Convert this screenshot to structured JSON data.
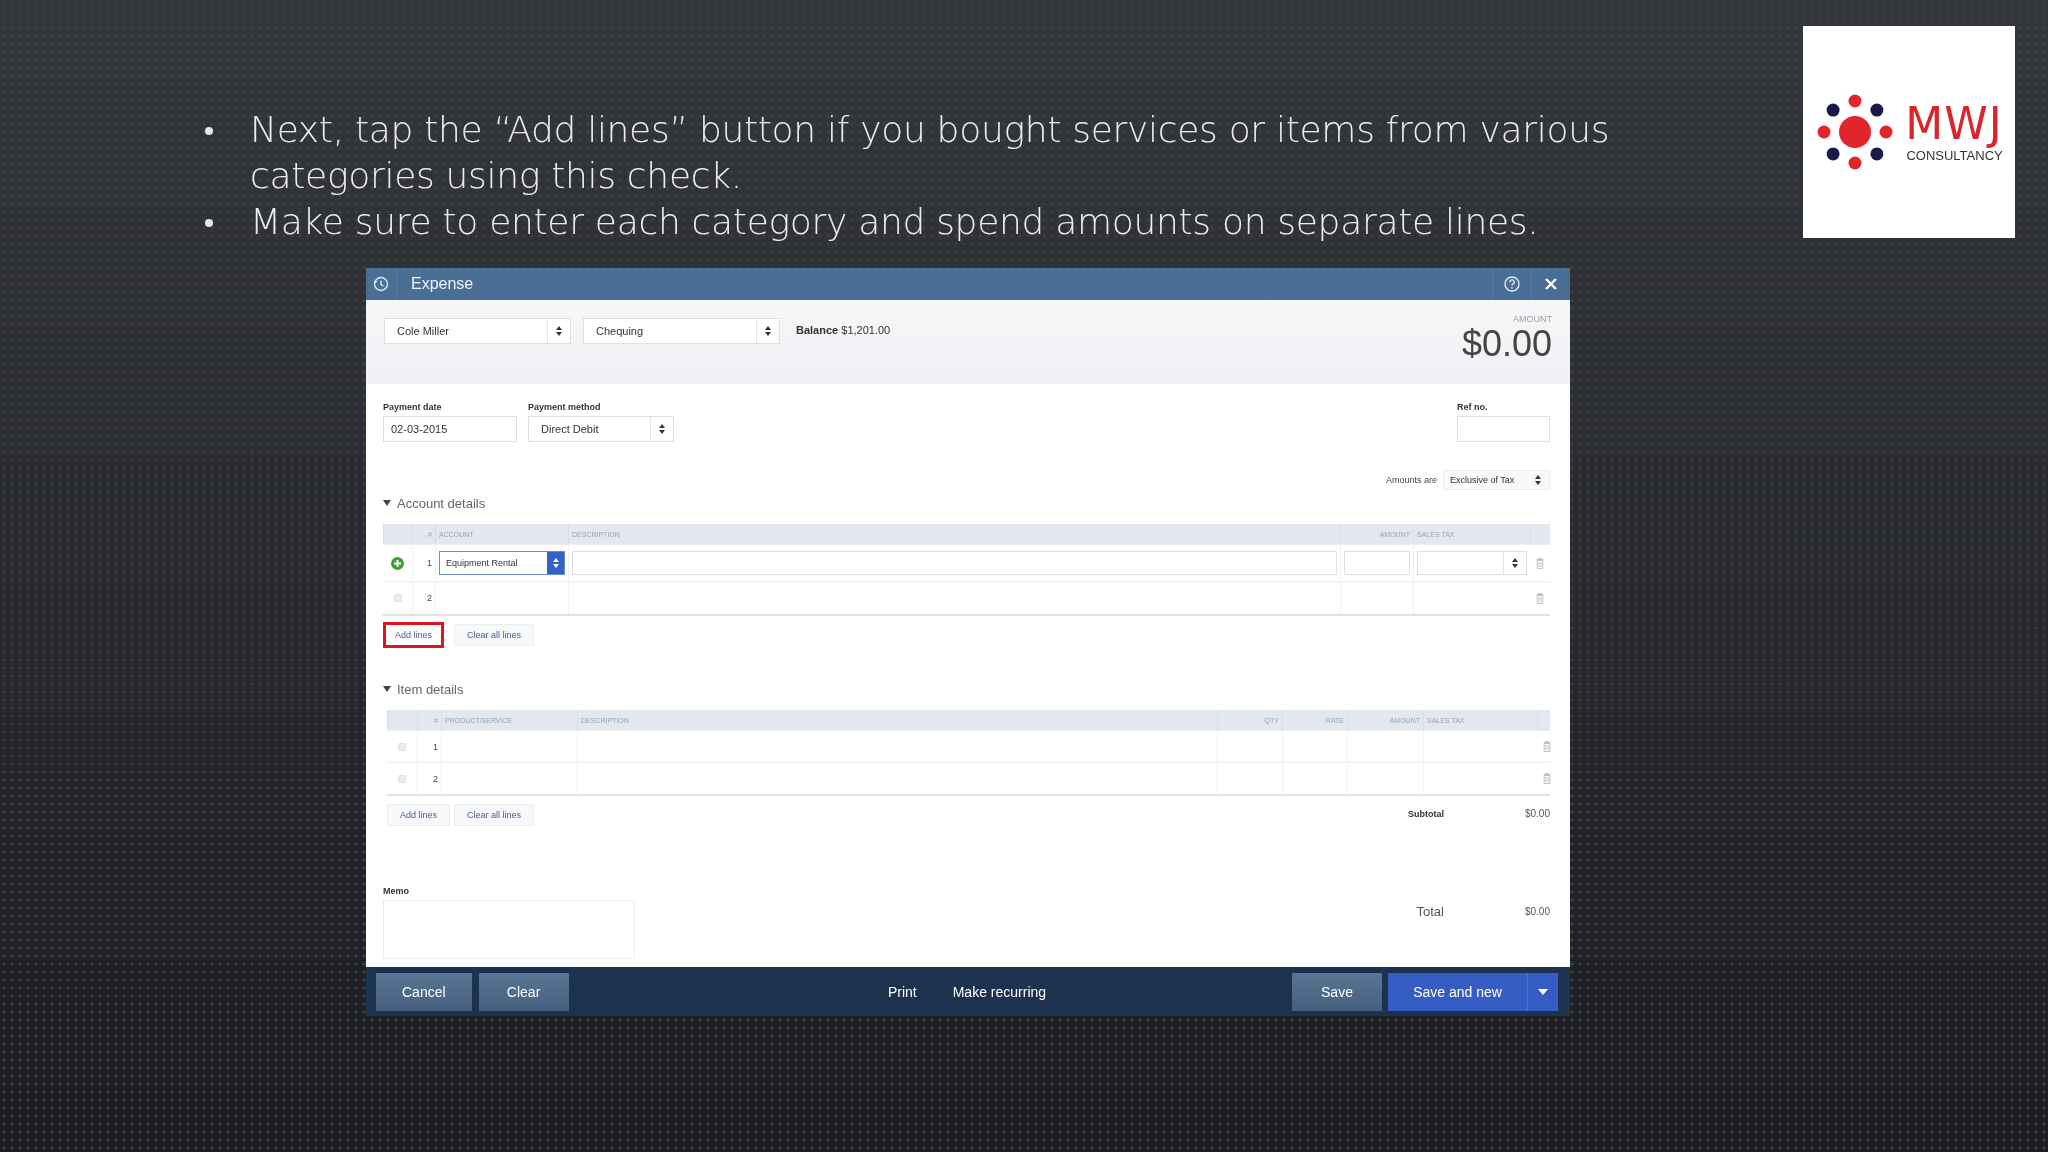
{
  "slide": {
    "bullets": [
      "Next, tap the “Add lines” button if you bought services or items from various categories using this check.",
      "Make sure to enter each category and spend amounts on separate lines."
    ],
    "logo": {
      "brand": "MWJ",
      "tagline": "CONSULTANCY"
    }
  },
  "window": {
    "title": "Expense"
  },
  "header": {
    "payee": "Cole Miller",
    "account": "Chequing",
    "balance_label": "Balance",
    "balance": "$1,201.00",
    "amount_label": "AMOUNT",
    "amount": "$0.00"
  },
  "payment": {
    "date_label": "Payment date",
    "date": "02-03-2015",
    "method_label": "Payment method",
    "method": "Direct Debit",
    "ref_label": "Ref no."
  },
  "amounts_are": {
    "label": "Amounts are",
    "value": "Exclusive of Tax"
  },
  "account_details": {
    "title": "Account details",
    "expanded": true,
    "columns": [
      "#",
      "ACCOUNT",
      "DESCRIPTION",
      "AMOUNT",
      "SALES TAX"
    ],
    "rows": [
      {
        "number": "1",
        "account": "Equipment Rental",
        "editing": true
      },
      {
        "number": "2",
        "editing": false
      }
    ],
    "buttons": [
      {
        "label": "Add lines",
        "highlighted": true
      },
      {
        "label": "Clear all lines",
        "highlighted": false
      }
    ]
  },
  "item_details": {
    "title": "Item details",
    "expanded": true,
    "columns": [
      "#",
      "PRODUCT/SERVICE",
      "DESCRIPTION",
      "QTY",
      "RATE",
      "AMOUNT",
      "SALES TAX"
    ],
    "rows": [
      {
        "number": "1"
      },
      {
        "number": "2"
      }
    ],
    "buttons": [
      {
        "label": "Add lines",
        "highlighted": false
      },
      {
        "label": "Clear all lines",
        "highlighted": false
      }
    ]
  },
  "subtotal": {
    "label": "Subtotal",
    "value": "$0.00"
  },
  "memo": {
    "label": "Memo"
  },
  "total": {
    "label": "Total",
    "value": "$0.00"
  },
  "footer": {
    "left": [
      {
        "label": "Cancel",
        "kind": "secondary"
      },
      {
        "label": "Clear",
        "kind": "secondary"
      }
    ],
    "center": [
      {
        "label": "Print",
        "kind": "link"
      },
      {
        "label": "Make recurring",
        "kind": "link"
      }
    ],
    "right": [
      {
        "label": "Save",
        "kind": "secondary"
      },
      {
        "label": "Save and new",
        "kind": "primary"
      }
    ]
  }
}
